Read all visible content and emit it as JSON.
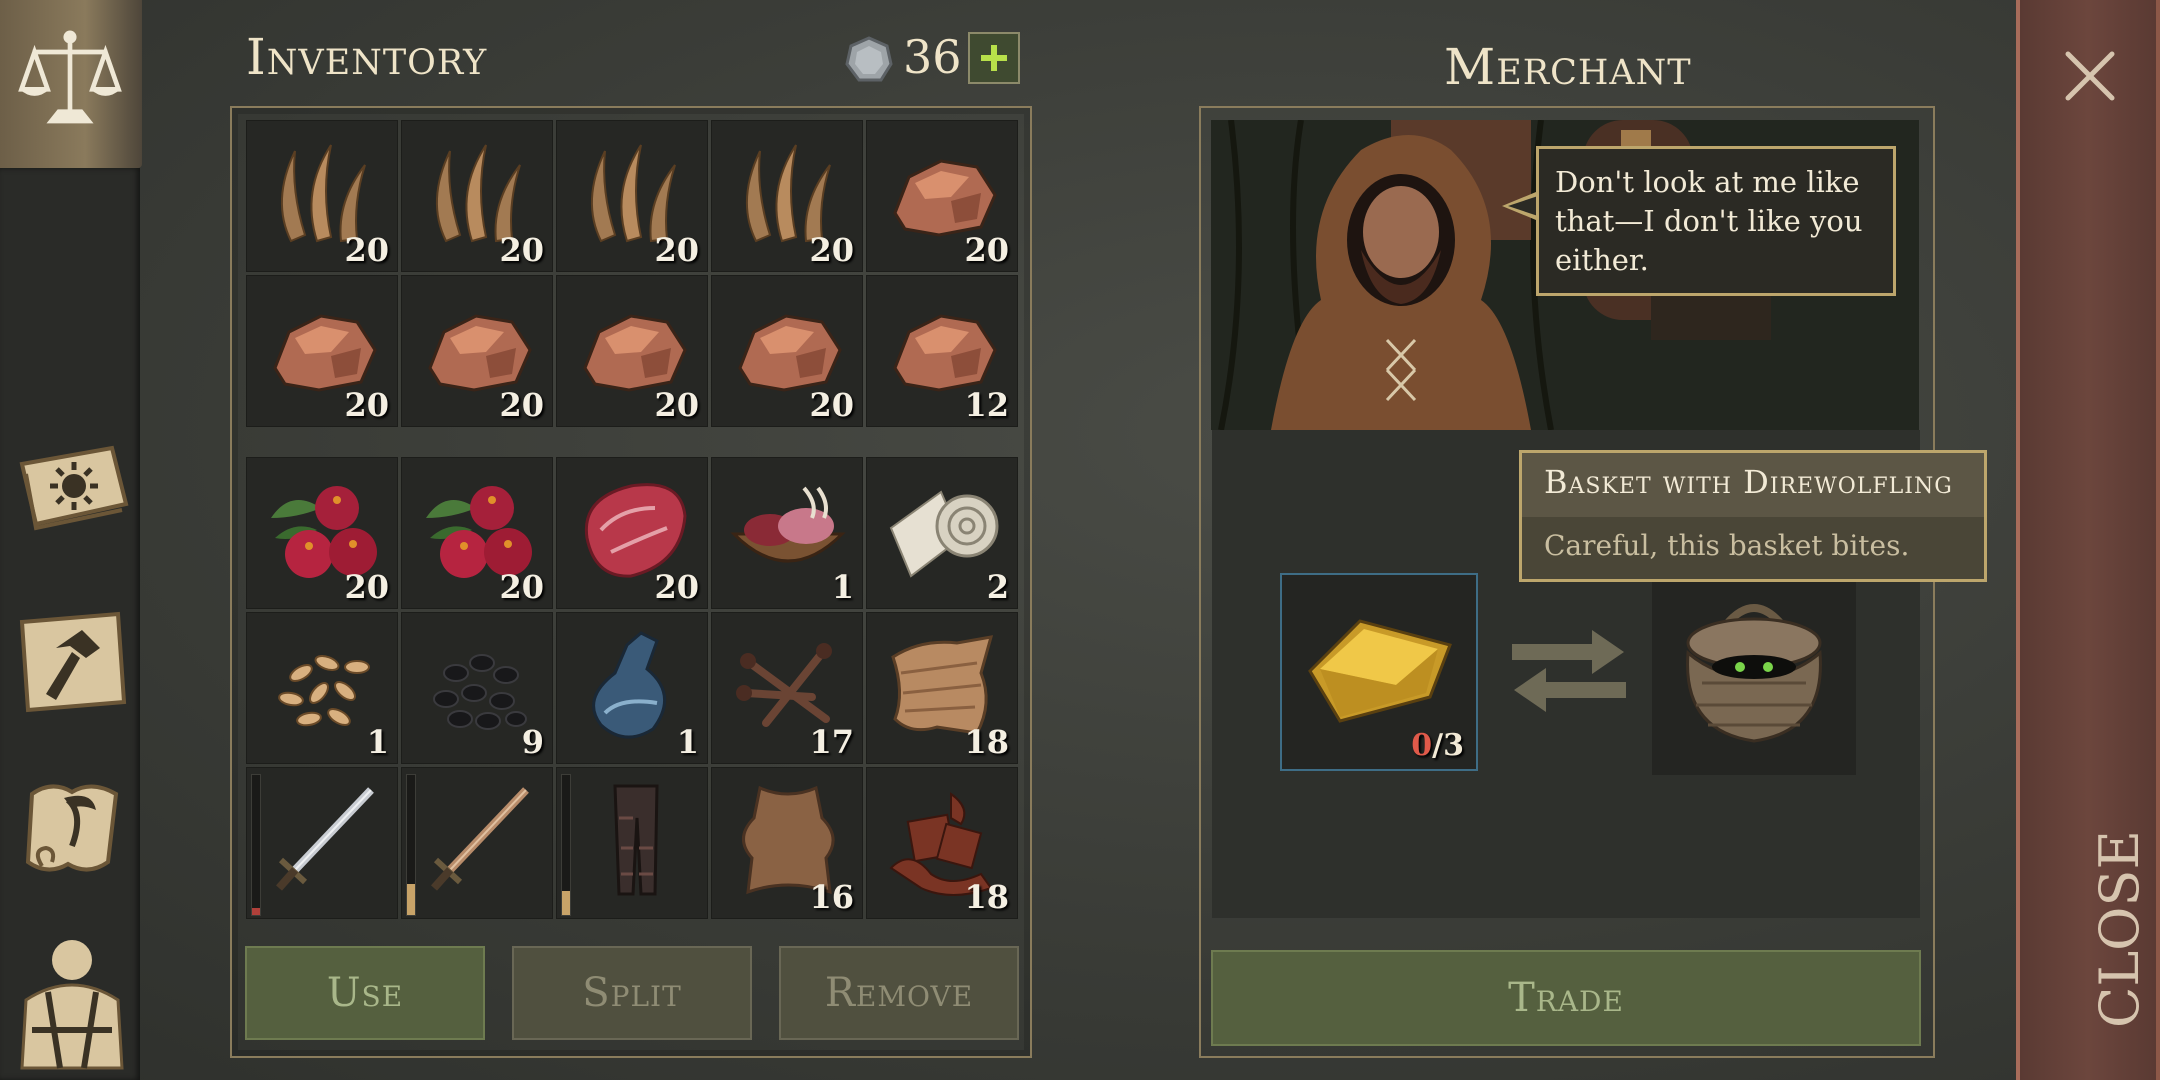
{
  "inventory": {
    "title": "Inventory",
    "currency_count": "36",
    "grid_top": [
      {
        "item": "fiber",
        "qty": "20"
      },
      {
        "item": "fiber",
        "qty": "20"
      },
      {
        "item": "fiber",
        "qty": "20"
      },
      {
        "item": "fiber",
        "qty": "20"
      },
      {
        "item": "copper-ore",
        "qty": "20"
      },
      {
        "item": "copper-ore",
        "qty": "20"
      },
      {
        "item": "copper-ore",
        "qty": "20"
      },
      {
        "item": "copper-ore",
        "qty": "20"
      },
      {
        "item": "copper-ore",
        "qty": "20"
      },
      {
        "item": "copper-ore",
        "qty": "12"
      }
    ],
    "grid_bottom": [
      {
        "item": "berries",
        "qty": "20"
      },
      {
        "item": "berries",
        "qty": "20"
      },
      {
        "item": "raw-meat",
        "qty": "20"
      },
      {
        "item": "entrails-bowl",
        "qty": "1"
      },
      {
        "item": "bandage-roll",
        "qty": "2"
      },
      {
        "item": "seeds",
        "qty": "1"
      },
      {
        "item": "coal",
        "qty": "9"
      },
      {
        "item": "flask",
        "qty": "1"
      },
      {
        "item": "nails",
        "qty": "17"
      },
      {
        "item": "cloth",
        "qty": "18"
      },
      {
        "item": "steel-sword",
        "qty": "",
        "durability": 0.05,
        "durability_color": "#b0403a"
      },
      {
        "item": "copper-sword",
        "qty": "",
        "durability": 0.22,
        "durability_color": "#c8a368"
      },
      {
        "item": "leather-pants",
        "qty": "",
        "durability": 0.17,
        "durability_color": "#c8a368"
      },
      {
        "item": "hide",
        "qty": "16"
      },
      {
        "item": "leather-scraps",
        "qty": "18"
      }
    ],
    "buttons": {
      "use": "Use",
      "split": "Split",
      "remove": "Remove"
    }
  },
  "merchant": {
    "title": "Merchant",
    "speech": "Don't look at me like that—I don't like you either.",
    "offer_item": {
      "name": "Basket with Direwolfling",
      "description": "Careful, this basket bites."
    },
    "price": {
      "have": "0",
      "need": "/3",
      "have_color": "#e05a4a"
    },
    "trade_label": "Trade"
  },
  "close_label": "CLOSE",
  "colors": {
    "accent_green": "#55603f",
    "frame_gold": "#bda66c",
    "close_red": "#6c463d"
  }
}
